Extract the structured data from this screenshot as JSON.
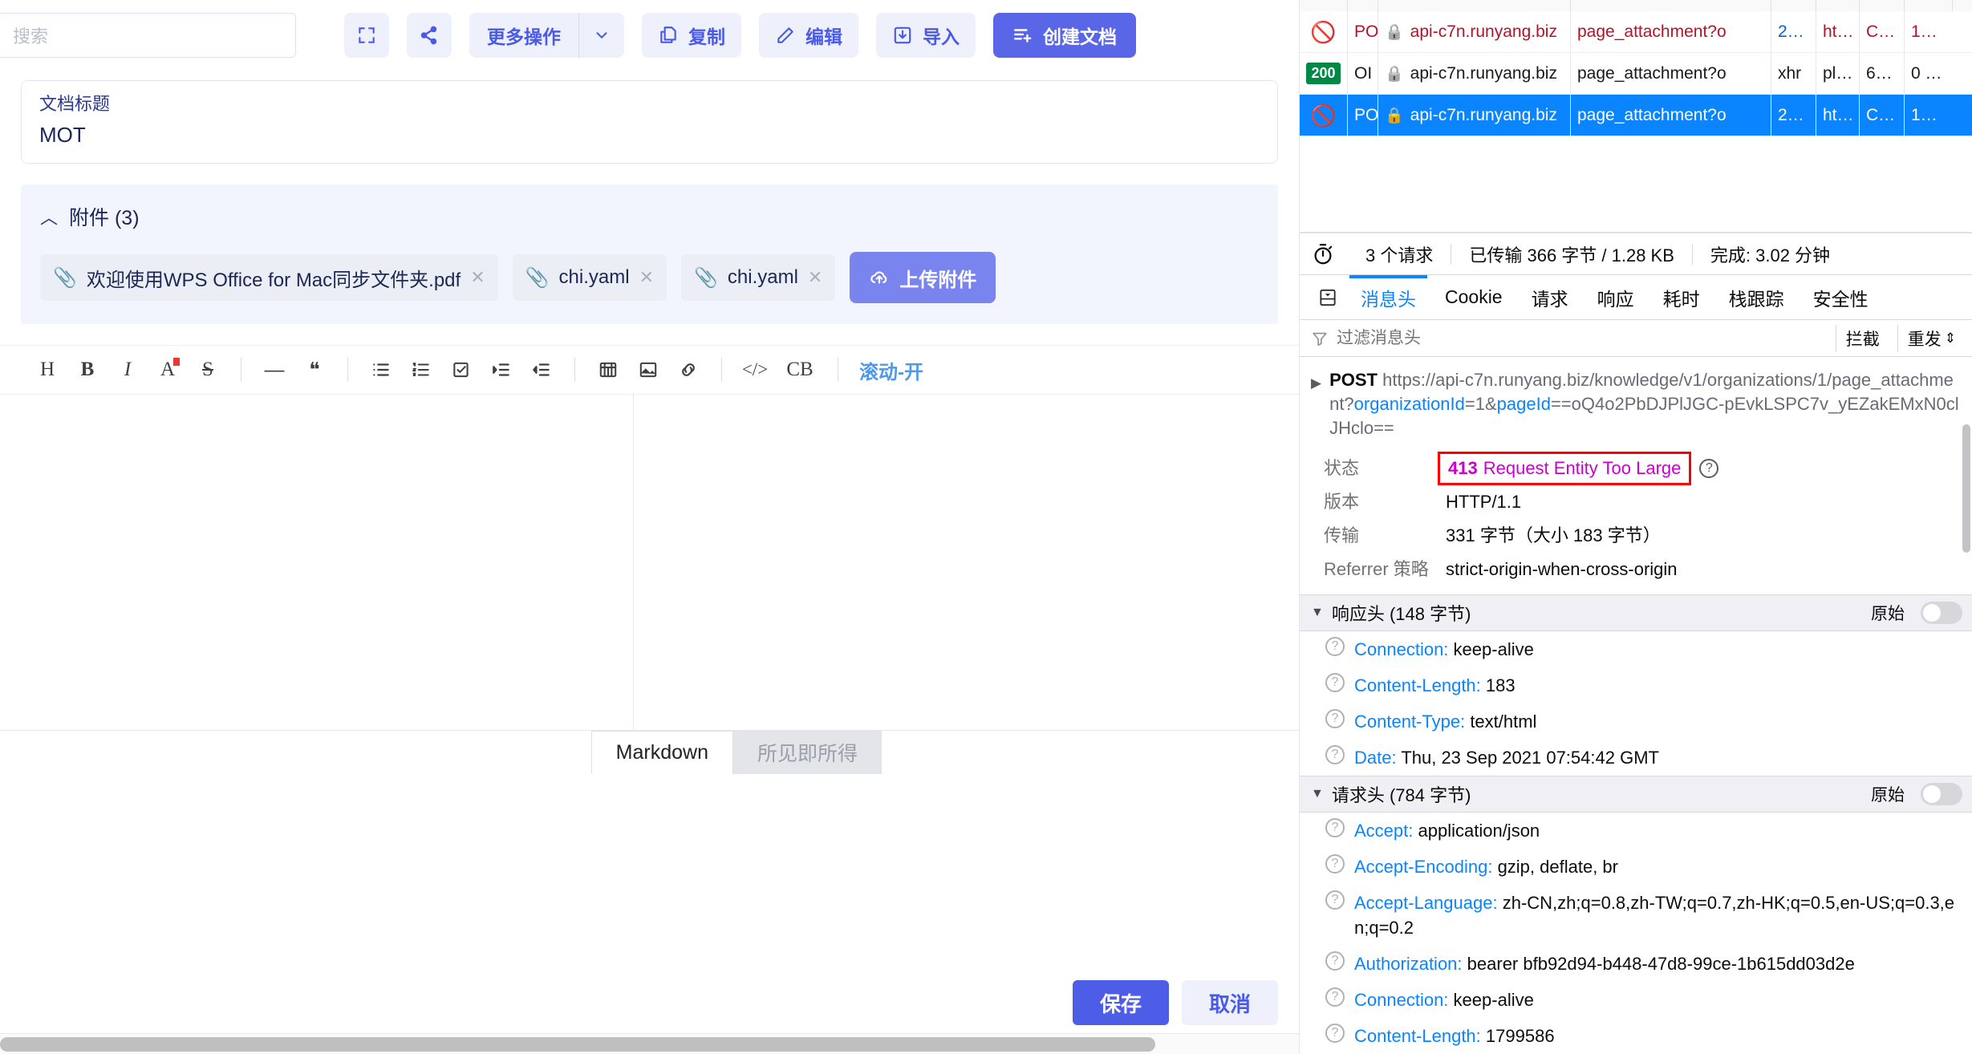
{
  "editor": {
    "search": {
      "placeholder": "搜索",
      "value": ""
    },
    "toolbar": {
      "fullscreen_icon": "fullscreen-icon",
      "share_icon": "share-icon",
      "more_actions_label": "更多操作",
      "more_actions_caret": "⌄",
      "copy_label": "复制",
      "edit_label": "编辑",
      "import_label": "导入",
      "create_doc_label": "创建文档"
    },
    "title_card": {
      "label": "文档标题",
      "value": "MOT"
    },
    "attachments": {
      "caret": "︿",
      "title": "附件 (3)",
      "items": [
        {
          "name": "欢迎使用WPS Office for Mac同步文件夹.pdf",
          "remove": "✕"
        },
        {
          "name": "chi.yaml",
          "remove": "✕"
        },
        {
          "name": "chi.yaml",
          "remove": "✕"
        }
      ],
      "upload_label": "上传附件"
    },
    "format_toolbar": {
      "items": [
        {
          "name": "heading",
          "glyph": "H"
        },
        {
          "name": "bold",
          "glyph": "B"
        },
        {
          "name": "italic",
          "glyph": "I"
        },
        {
          "name": "font-color",
          "glyph": "A"
        },
        {
          "name": "strikethrough",
          "glyph": "S"
        },
        {
          "name": "horizontal-rule",
          "glyph": "—"
        },
        {
          "name": "blockquote",
          "glyph": "❝"
        },
        {
          "name": "bullet-list",
          "glyph": "☰"
        },
        {
          "name": "ordered-list",
          "glyph": "≡"
        },
        {
          "name": "checklist",
          "glyph": "☑"
        },
        {
          "name": "indent",
          "glyph": "⇥"
        },
        {
          "name": "outdent",
          "glyph": "⇤"
        },
        {
          "name": "table",
          "glyph": "▦"
        },
        {
          "name": "image",
          "glyph": "🖼"
        },
        {
          "name": "link",
          "glyph": "🔗"
        },
        {
          "name": "code",
          "glyph": "</>"
        },
        {
          "name": "code-block",
          "glyph": "CB"
        }
      ],
      "scroll_toggle_label": "滚动-开"
    },
    "mode_tabs": [
      {
        "label": "Markdown",
        "active": true
      },
      {
        "label": "所见即所得",
        "active": false
      }
    ],
    "footer": {
      "save_label": "保存",
      "cancel_label": "取消"
    }
  },
  "devtools": {
    "request_rows": [
      {
        "status_icon": "blocked",
        "status_badge": "",
        "method": "PO",
        "lock": "🔒",
        "domain": "api-c7n.runyang.biz",
        "file": "page_attachment?o",
        "type": "2…",
        "transferred": "ht…",
        "size": "C…",
        "time": "1…",
        "state": "error"
      },
      {
        "status_icon": "",
        "status_badge": "200",
        "method": "OI",
        "lock": "🔒",
        "domain": "api-c7n.runyang.biz",
        "file": "page_attachment?o",
        "type": "xhr",
        "transferred": "pl…",
        "size": "6…",
        "time": "0 …",
        "state": "ok"
      },
      {
        "status_icon": "blocked",
        "status_badge": "",
        "method": "PO",
        "lock": "🔒",
        "domain": "api-c7n.runyang.biz",
        "file": "page_attachment?o",
        "type": "2…",
        "transferred": "ht…",
        "size": "C…",
        "time": "1…",
        "state": "selected"
      }
    ],
    "summary": {
      "clock_icon": "stopwatch-icon",
      "requests": "3 个请求",
      "transferred": "已传输 366 字节 / 1.28 KB",
      "finished": "完成: 3.02 分钟"
    },
    "detail_tabs": [
      {
        "label": "消息头",
        "active": true
      },
      {
        "label": "Cookie",
        "active": false
      },
      {
        "label": "请求",
        "active": false
      },
      {
        "label": "响应",
        "active": false
      },
      {
        "label": "耗时",
        "active": false
      },
      {
        "label": "栈跟踪",
        "active": false
      },
      {
        "label": "安全性",
        "active": false
      }
    ],
    "filter": {
      "placeholder": "过滤消息头",
      "block_label": "拦截",
      "resend_label": "重发",
      "resend_caret": "⇕"
    },
    "request_url": {
      "caret": "▶",
      "method": "POST",
      "prefix": "https://api-c7n.runyang.biz/knowledge/v1/organizations/1/page_attachment?",
      "param1_key": "organizationId",
      "param1_mid": "=1&",
      "param2_key": "pageId",
      "param2_val": "==oQ4o2PbDJPlJGC-pEvkLSPC7v_yEZakEMxN0clJHclo=="
    },
    "overview": [
      {
        "key": "状态",
        "value": "",
        "status_code": "413",
        "status_text": "Request Entity Too Large",
        "highlight": true,
        "help": "?"
      },
      {
        "key": "版本",
        "value": "HTTP/1.1"
      },
      {
        "key": "传输",
        "value": "331 字节（大小 183 字节）"
      },
      {
        "key": "Referrer 策略",
        "value": "strict-origin-when-cross-origin"
      }
    ],
    "response_headers": {
      "caret": "▼",
      "title": "响应头 (148 字节)",
      "raw_label": "原始",
      "items": [
        {
          "name": "Connection:",
          "value": "keep-alive"
        },
        {
          "name": "Content-Length:",
          "value": "183"
        },
        {
          "name": "Content-Type:",
          "value": "text/html"
        },
        {
          "name": "Date:",
          "value": "Thu, 23 Sep 2021 07:54:42 GMT"
        }
      ]
    },
    "request_headers": {
      "caret": "▼",
      "title": "请求头 (784 字节)",
      "raw_label": "原始",
      "items": [
        {
          "name": "Accept:",
          "value": "application/json"
        },
        {
          "name": "Accept-Encoding:",
          "value": "gzip, deflate, br"
        },
        {
          "name": "Accept-Language:",
          "value": "zh-CN,zh;q=0.8,zh-TW;q=0.7,zh-HK;q=0.5,en-US;q=0.3,en;q=0.2"
        },
        {
          "name": "Authorization:",
          "value": "bearer bfb92d94-b448-47d8-99ce-1b615dd03d2e"
        },
        {
          "name": "Connection:",
          "value": "keep-alive"
        },
        {
          "name": "Content-Length:",
          "value": "1799586"
        }
      ]
    }
  },
  "colors": {
    "brand": "#5a66e8",
    "brand_soft": "#eef1fb",
    "devtools_link": "#0a84ff",
    "status_magenta": "#cc00cc",
    "error_red": "#b5122a",
    "ok_green": "#018845",
    "highlight_border": "#ff0000"
  }
}
